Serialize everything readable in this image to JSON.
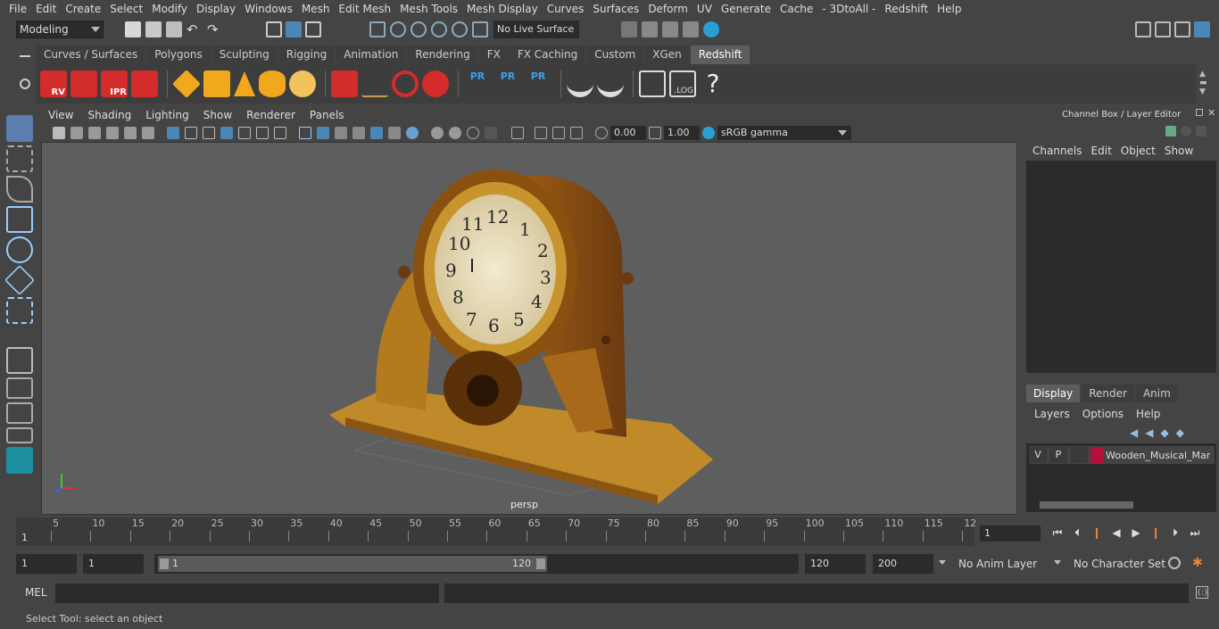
{
  "menubar": [
    "File",
    "Edit",
    "Create",
    "Select",
    "Modify",
    "Display",
    "Windows",
    "Mesh",
    "Edit Mesh",
    "Mesh Tools",
    "Mesh Display",
    "Curves",
    "Surfaces",
    "Deform",
    "UV",
    "Generate",
    "Cache",
    "- 3DtoAll -",
    "Redshift",
    "Help"
  ],
  "status": {
    "mode": "Modeling",
    "live_surface": "No Live Surface"
  },
  "shelf_tabs": [
    "Curves / Surfaces",
    "Polygons",
    "Sculpting",
    "Rigging",
    "Animation",
    "Rendering",
    "FX",
    "FX Caching",
    "Custom",
    "XGen",
    "Redshift"
  ],
  "shelf_active": "Redshift",
  "shelf_labels": {
    "rv": "RV",
    "ipr": "IPR",
    "pr1": "PR",
    "pr2": "PR",
    "pr3": "PR",
    "log": ".LOG",
    "help": "?"
  },
  "panel_menu": [
    "View",
    "Shading",
    "Lighting",
    "Show",
    "Renderer",
    "Panels"
  ],
  "viewport_tools": {
    "exposure": "0.00",
    "gamma": "1.00",
    "color_space": "sRGB gamma"
  },
  "viewport": {
    "camera_label": "persp"
  },
  "channel_box": {
    "title": "Channel Box / Layer Editor",
    "menus": [
      "Channels",
      "Edit",
      "Object",
      "Show"
    ]
  },
  "layer_editor": {
    "tabs": [
      "Display",
      "Render",
      "Anim"
    ],
    "active_tab": "Display",
    "menus": [
      "Layers",
      "Options",
      "Help"
    ],
    "layers": [
      {
        "v": "V",
        "p": "P",
        "name": "Wooden_Musical_Mar",
        "color": "#b3103a"
      }
    ]
  },
  "timeline": {
    "ticks": [
      "5",
      "10",
      "15",
      "20",
      "25",
      "30",
      "35",
      "40",
      "45",
      "50",
      "55",
      "60",
      "65",
      "70",
      "75",
      "80",
      "85",
      "90",
      "95",
      "100",
      "105",
      "110",
      "115",
      "12"
    ],
    "start_marker": "1",
    "current_frame": "1"
  },
  "range": {
    "start": "1",
    "current": "1",
    "slider_start": "1",
    "slider_end": "120",
    "end": "120",
    "total_end": "200",
    "anim_layer": "No Anim Layer",
    "character_set": "No Character Set"
  },
  "command_line": {
    "label": "MEL"
  },
  "help_line": "Select Tool: select an object"
}
